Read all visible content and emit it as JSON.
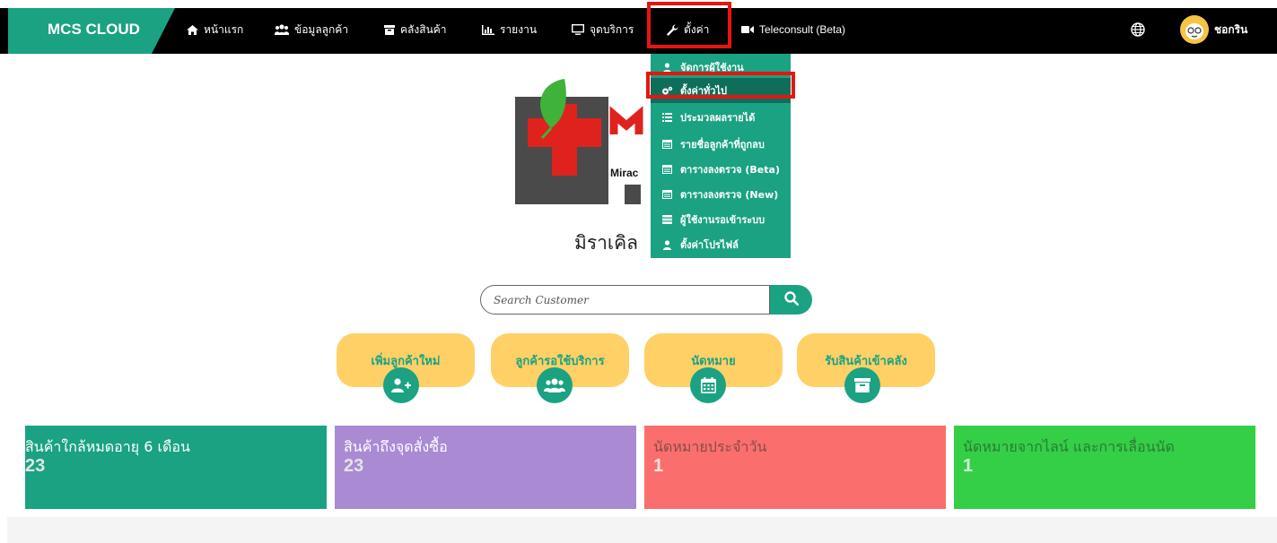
{
  "brand": "MCS CLOUD",
  "nav": {
    "home": "หน้าแรก",
    "customers": "ข้อมูลลูกค้า",
    "inventory": "คลังสินค้า",
    "reports": "รายงาน",
    "service_points": "จุดบริการ",
    "settings": "ตั้งค่า",
    "teleconsult": "Teleconsult (Beta)"
  },
  "user": {
    "name": "ชอกริน"
  },
  "settings_menu": [
    {
      "label": "จัดการผู้ใช้งาน",
      "icon": "user-icon"
    },
    {
      "label": "ตั้งค่าทั่วไป",
      "icon": "gears-icon"
    },
    {
      "label": "ประมวลผลรายได้",
      "icon": "list-icon"
    },
    {
      "label": "รายชื่อลูกค้าที่ถูกลบ",
      "icon": "table-icon"
    },
    {
      "label": "ตารางลงตรวจ (Beta)",
      "icon": "table-icon"
    },
    {
      "label": "ตารางลงตรวจ (New)",
      "icon": "table-icon"
    },
    {
      "label": "ผู้ใช้งานรอเข้าระบบ",
      "icon": "table-icon"
    },
    {
      "label": "ตั้งค่าโปรไฟล์",
      "icon": "user-icon"
    }
  ],
  "logo": {
    "partial_text": "Mirac"
  },
  "clinic": {
    "name": "มิราเคิล"
  },
  "search": {
    "placeholder": "Search Customer"
  },
  "actions": [
    {
      "label": "เพิ่มลูกค้าใหม่",
      "icon": "user-plus-icon"
    },
    {
      "label": "ลูกค้ารอใช้บริการ",
      "icon": "users-icon"
    },
    {
      "label": "นัดหมาย",
      "icon": "calendar-icon"
    },
    {
      "label": "รับสินค้าเข้าคลัง",
      "icon": "archive-icon"
    }
  ],
  "cards": [
    {
      "title": "สินค้าใกล้หมดอายุ 6 เดือน",
      "value": "23",
      "color": "#1aa283"
    },
    {
      "title": "สินค้าถึงจุดสั่งซื้อ",
      "value": "23",
      "color": "#a98ad3"
    },
    {
      "title": "นัดหมายประจำวัน",
      "value": "1",
      "color": "#fa6f6d"
    },
    {
      "title": "นัดหมายจากไลน์ และการเลื่อนนัด",
      "value": "1",
      "color": "#34cf47"
    }
  ],
  "colors": {
    "accent": "#1aa283",
    "highlight": "#e8140f",
    "action_bg": "#ffd066"
  }
}
